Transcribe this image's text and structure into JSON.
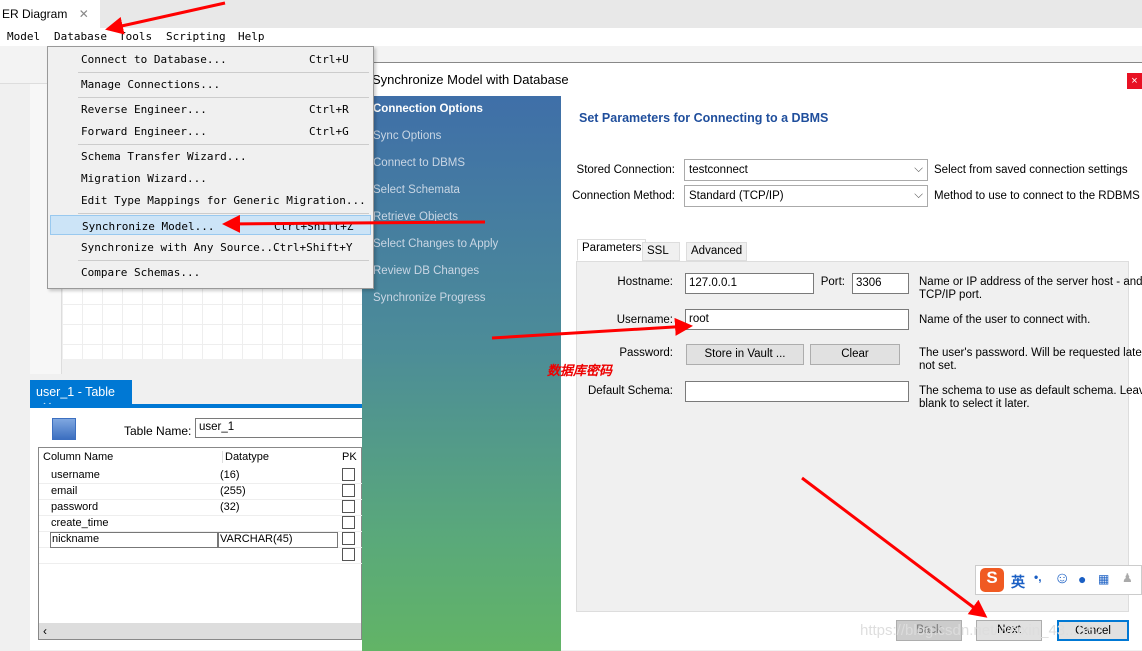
{
  "app": {
    "doc_tab": "ER Diagram",
    "menubar": [
      "Model",
      "Database",
      "Tools",
      "Scripting",
      "Help"
    ]
  },
  "menu": {
    "items": [
      {
        "label": "Connect to Database...",
        "shortcut": "Ctrl+U"
      },
      {
        "label": "Manage Connections...",
        "shortcut": ""
      },
      {
        "label": "Reverse Engineer...",
        "shortcut": "Ctrl+R"
      },
      {
        "label": "Forward Engineer...",
        "shortcut": "Ctrl+G"
      },
      {
        "label": "Schema Transfer Wizard...",
        "shortcut": ""
      },
      {
        "label": "Migration Wizard...",
        "shortcut": ""
      },
      {
        "label": "Edit Type Mappings for Generic Migration...",
        "shortcut": ""
      },
      {
        "label": "Synchronize Model...",
        "shortcut": "Ctrl+Shift+Z"
      },
      {
        "label": "Synchronize with Any Source...",
        "shortcut": "Ctrl+Shift+Y"
      },
      {
        "label": "Compare Schemas...",
        "shortcut": ""
      }
    ]
  },
  "table_editor": {
    "tab": "user_1 - Table",
    "table_name_label": "Table Name:",
    "table_name": "user_1",
    "headers": [
      "Column Name",
      "Datatype",
      "PK"
    ],
    "rows": [
      {
        "name": "username",
        "type": "(16)"
      },
      {
        "name": "email",
        "type": "(255)"
      },
      {
        "name": "password",
        "type": "(32)"
      },
      {
        "name": "create_time",
        "type": ""
      },
      {
        "name": "nickname",
        "type": "VARCHAR(45)"
      }
    ]
  },
  "dialog": {
    "title": "Synchronize Model with Database",
    "close": "×",
    "steps": [
      "Connection Options",
      "Sync Options",
      "Connect to DBMS",
      "Select Schemata",
      "Retrieve Objects",
      "Select Changes to Apply",
      "Review DB Changes",
      "Synchronize Progress"
    ],
    "heading": "Set Parameters for Connecting to a DBMS",
    "stored_connection": {
      "label": "Stored Connection:",
      "value": "testconnect",
      "hint": "Select from saved connection settings"
    },
    "connection_method": {
      "label": "Connection Method:",
      "value": "Standard (TCP/IP)",
      "hint": "Method to use to connect to the RDBMS"
    },
    "tabs": [
      "Parameters",
      "SSL",
      "Advanced"
    ],
    "hostname": {
      "label": "Hostname:",
      "value": "127.0.0.1",
      "hint1": "Name or IP address of the server host - and",
      "hint2": "TCP/IP port."
    },
    "port": {
      "label": "Port:",
      "value": "3306"
    },
    "username": {
      "label": "Username:",
      "value": "root",
      "hint": "Name of the user to connect with."
    },
    "password": {
      "label": "Password:",
      "store": "Store in Vault ...",
      "clear": "Clear",
      "hint1": "The user's password. Will be requested later",
      "hint2": "not set."
    },
    "schema": {
      "label": "Default Schema:",
      "value": "",
      "hint1": "The schema to use as default schema. Leave",
      "hint2": "blank to select it later."
    },
    "buttons": {
      "back": "Back",
      "next": "Next",
      "cancel": "Cancel"
    }
  },
  "annotation": "数据库密码",
  "ime": {
    "lang": "英",
    "punct": "•,"
  },
  "watermark": "https://blog.csdn.net/weixin_43...587",
  "colors": {
    "accent": "#0078d4",
    "arrow": "#ff0000",
    "heading": "#1f4e9c"
  }
}
